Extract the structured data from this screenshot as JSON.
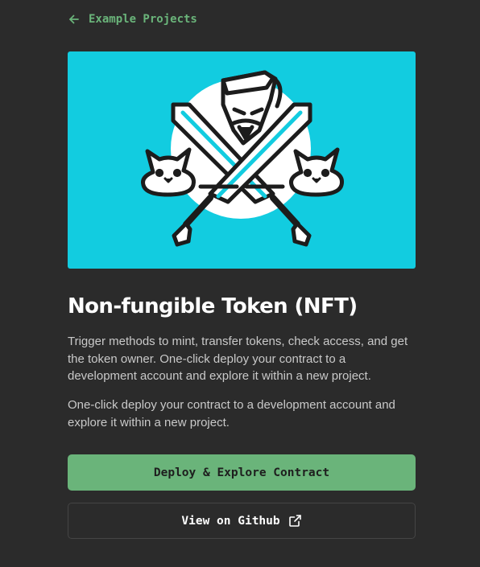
{
  "back_link": {
    "label": "Example Projects",
    "icon": "arrow-left-icon"
  },
  "hero": {
    "image": "nft-illustration",
    "background_color": "#12cce0"
  },
  "project": {
    "title": "Non-fungible Token (NFT)",
    "description_1": "Trigger methods to mint, transfer tokens, check access, and get the token owner. One-click deploy your contract to a development account and explore it within a new project.",
    "description_2": "One-click deploy your contract to a development account and explore it within a new project."
  },
  "actions": {
    "deploy_label": "Deploy & Explore Contract",
    "github_label": "View on Github",
    "github_icon": "external-link-icon"
  },
  "colors": {
    "background": "#2b2b2b",
    "accent": "#6ab47a",
    "hero": "#12cce0"
  }
}
